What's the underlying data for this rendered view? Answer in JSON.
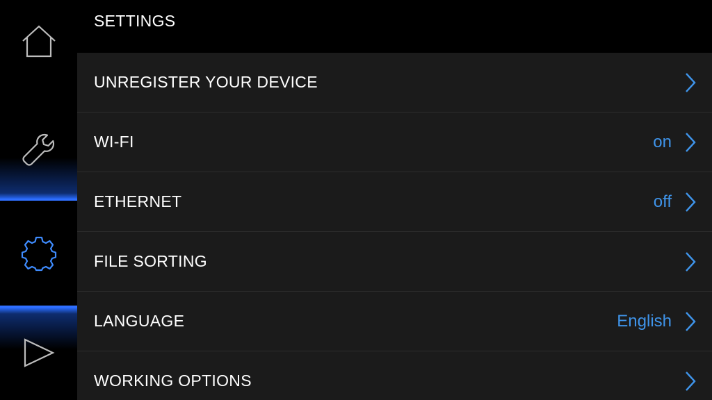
{
  "header": {
    "title": "SETTINGS"
  },
  "sidebar": {
    "items": [
      {
        "icon": "home-icon",
        "active": false
      },
      {
        "icon": "wrench-icon",
        "active": false
      },
      {
        "icon": "gear-icon",
        "active": true
      },
      {
        "icon": "play-icon",
        "active": false
      }
    ]
  },
  "settings": {
    "rows": [
      {
        "label": "UNREGISTER YOUR DEVICE",
        "value": ""
      },
      {
        "label": "WI-FI",
        "value": "on"
      },
      {
        "label": "ETHERNET",
        "value": "off"
      },
      {
        "label": "FILE SORTING",
        "value": ""
      },
      {
        "label": "LANGUAGE",
        "value": "English"
      },
      {
        "label": "WORKING OPTIONS",
        "value": ""
      }
    ]
  },
  "colors": {
    "accent": "#3f94ea",
    "row_background": "#1b1b1b",
    "background": "#000000",
    "active_icon": "#3f8cff",
    "inactive_icon": "#bdbdbd"
  }
}
